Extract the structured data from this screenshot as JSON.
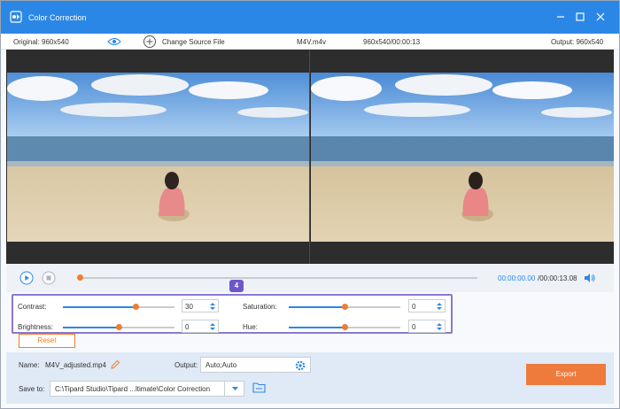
{
  "window": {
    "title": "Color Correction",
    "accent": "#2b87e6"
  },
  "infobar": {
    "original": "Original: 960x540",
    "change_source": "Change Source File",
    "filename": "M4V.m4v",
    "meta": "960x540/00:00:13",
    "output": "Output: 960x540"
  },
  "transport": {
    "time_current": "00:00:00.00",
    "time_total": "/00:00:13.08",
    "progress_fraction": 0.0
  },
  "annotation_badge": "4",
  "adjustments": {
    "contrast": {
      "label": "Contrast:",
      "value": "30",
      "slider_fraction": 0.65
    },
    "saturation": {
      "label": "Saturation:",
      "value": "0",
      "slider_fraction": 0.5
    },
    "brightness": {
      "label": "Brightness:",
      "value": "0",
      "slider_fraction": 0.5
    },
    "hue": {
      "label": "Hue:",
      "value": "0",
      "slider_fraction": 0.5
    }
  },
  "reset_label": "Reset",
  "bottom": {
    "name_label": "Name:",
    "name_value": "M4V_adjusted.mp4",
    "output_label": "Output:",
    "output_value": "Auto;Auto",
    "saveto_label": "Save to:",
    "saveto_value": "C:\\Tipard Studio\\Tipard ...ltimate\\Color Correction",
    "export_label": "Export"
  },
  "colors": {
    "knob": "#f07d2e",
    "export": "#ee7a3c",
    "badge": "#6e57c9"
  }
}
